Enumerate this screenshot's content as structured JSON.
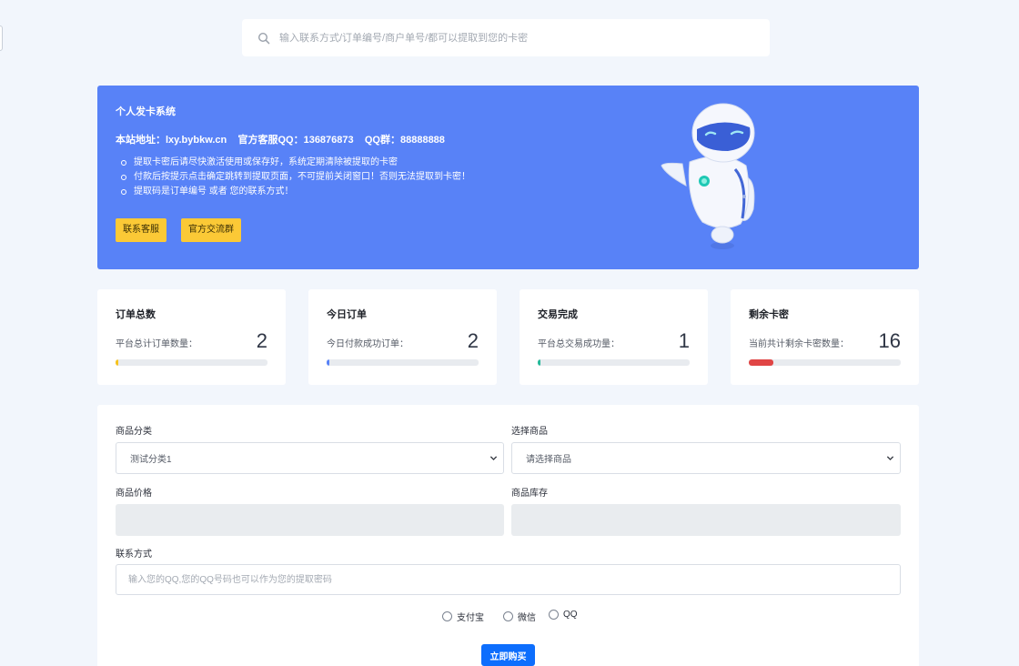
{
  "search": {
    "placeholder": "输入联系方式/订单编号/商户单号/都可以提取到您的卡密"
  },
  "banner": {
    "title": "个人发卡系统",
    "address_line": "本站地址：lxy.bybkw.cn    官方客服QQ：136876873    QQ群：88888888",
    "notices": [
      "提取卡密后请尽快激活使用或保存好，系统定期清除被提取的卡密",
      "付款后按提示点击确定跳转到提取页面，不可提前关闭窗口！否则无法提取到卡密！",
      "提取码是订单编号 或者 您的联系方式！"
    ],
    "buttons": {
      "contact": "联系客服",
      "group": "官方交流群"
    }
  },
  "stats": [
    {
      "title": "订单总数",
      "desc": "平台总计订单数量：",
      "value": "2",
      "progress": 0.02,
      "color": "#f7c31e"
    },
    {
      "title": "今日订单",
      "desc": "今日付款成功订单：",
      "value": "2",
      "progress": 0.02,
      "color": "#5882f7"
    },
    {
      "title": "交易完成",
      "desc": "平台总交易成功量：",
      "value": "1",
      "progress": 0.01,
      "color": "#25b99a"
    },
    {
      "title": "剩余卡密",
      "desc": "当前共计剩余卡密数量：",
      "value": "16",
      "progress": 0.16,
      "color": "#e04545"
    }
  ],
  "form": {
    "category_label": "商品分类",
    "category_value": "测试分类1",
    "product_label": "选择商品",
    "product_value": "请选择商品",
    "price_label": "商品价格",
    "stock_label": "商品库存",
    "contact_label": "联系方式",
    "contact_placeholder": "输入您的QQ,您的QQ号码也可以作为您的提取密码",
    "payment_options": [
      "支付宝",
      "微信",
      "QQ"
    ],
    "buy_label": "立即购买"
  }
}
